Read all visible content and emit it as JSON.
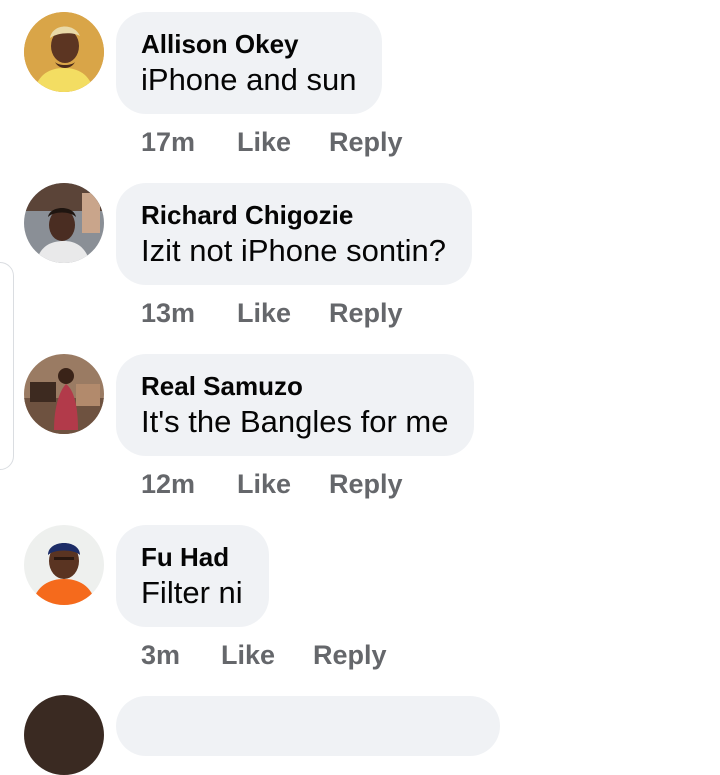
{
  "comments": [
    {
      "author": "Allison Okey",
      "text": "iPhone and sun",
      "time": "17m",
      "like": "Like",
      "reply": "Reply",
      "avatar_icon": "profile-photo"
    },
    {
      "author": "Richard Chigozie",
      "text": "Izit not iPhone sontin?",
      "time": "13m",
      "like": "Like",
      "reply": "Reply",
      "avatar_icon": "profile-photo"
    },
    {
      "author": "Real Samuzo",
      "text": "It's the Bangles for me",
      "time": "12m",
      "like": "Like",
      "reply": "Reply",
      "avatar_icon": "profile-photo"
    },
    {
      "author": "Fu Had",
      "text": "Filter ni",
      "time": "3m",
      "like": "Like",
      "reply": "Reply",
      "avatar_icon": "profile-photo"
    }
  ],
  "colors": {
    "bubble": "#f0f2f5",
    "meta_text": "#65676b",
    "primary_text": "#050505"
  }
}
